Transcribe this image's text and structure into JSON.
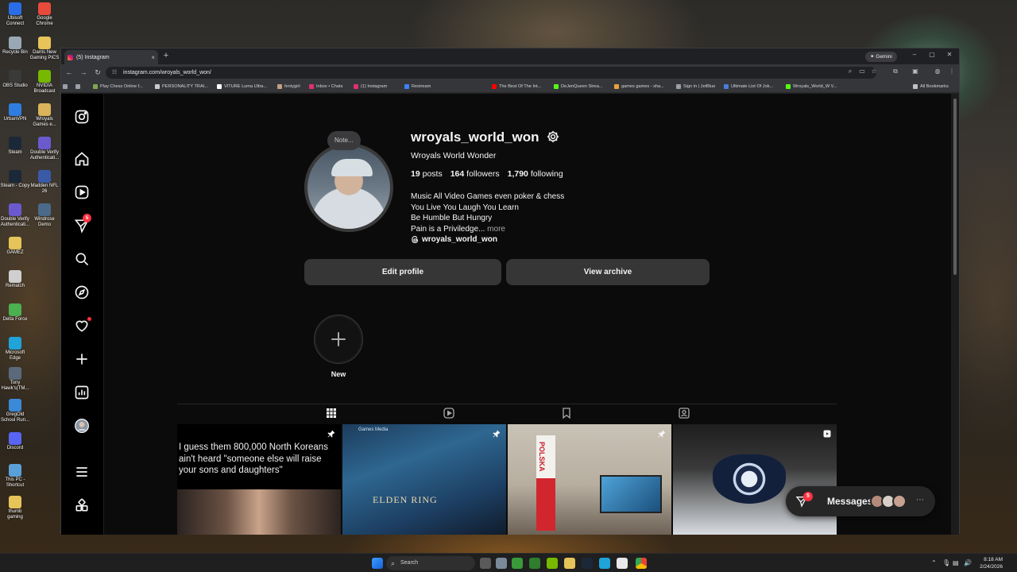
{
  "desktop": {
    "icons": [
      {
        "label": "Ubisoft Connect",
        "color": "#2b6de8"
      },
      {
        "label": "Google Chrome",
        "color": "#e84a3c"
      },
      {
        "label": "Recycle Bin",
        "color": "#9aa7b5"
      },
      {
        "label": "Darris New Gaming PICS",
        "color": "#e6c45a"
      },
      {
        "label": "OBS Studio",
        "color": "#3a3a3a"
      },
      {
        "label": "NVIDIA Broadcast",
        "color": "#76b900"
      },
      {
        "label": "UrbanVPN",
        "color": "#2f7de1"
      },
      {
        "label": "Wroyals Games e...",
        "color": "#d9b45a"
      },
      {
        "label": "Steam",
        "color": "#1b2838"
      },
      {
        "label": "Double Verify Authenticati...",
        "color": "#6a5acd"
      },
      {
        "label": "Steam - Copy",
        "color": "#1b2838"
      },
      {
        "label": "Madden NFL 26",
        "color": "#3a5aa8"
      },
      {
        "label": "Double Verify Authenticati...",
        "color": "#6a5acd"
      },
      {
        "label": "Windrose Demo",
        "color": "#4a6a8a"
      },
      {
        "label": "GAMEZ",
        "color": "#e6c45a"
      },
      {
        "label": "Rematch",
        "color": "#cfcfcf"
      },
      {
        "label": "Delta Force",
        "color": "#4caf50"
      },
      {
        "label": "Microsoft Edge",
        "color": "#1fa3d9"
      },
      {
        "label": "Tony Hawk's(TM...",
        "color": "#5a6a7a"
      },
      {
        "label": "GregOld School Run...",
        "color": "#3a8ad8"
      },
      {
        "label": "Discord",
        "color": "#5865f2"
      },
      {
        "label": "This PC - Shortcut",
        "color": "#5aa0d8"
      },
      {
        "label": "thumb gaming",
        "color": "#e6c45a"
      }
    ]
  },
  "browser": {
    "tab_title": "(5) Instagram",
    "tab_close": "×",
    "new_tab": "+",
    "gemini_label": "Gemini",
    "url": "instagram.com/wroyals_world_won/",
    "bookmarks": [
      {
        "label": "Play Chess Online f...",
        "color": "#7fa650"
      },
      {
        "label": "PERSONALITY TRAI...",
        "color": "#c9c9c9"
      },
      {
        "label": "VITURE Luma Ultra...",
        "color": "#ffffff"
      },
      {
        "label": "fentygirl",
        "color": "#c0a080"
      },
      {
        "label": "Inbox • Chats",
        "color": "#e1306c"
      },
      {
        "label": "(1) Instagram",
        "color": "#e1306c"
      },
      {
        "label": "Restream",
        "color": "#3b82f6"
      },
      {
        "label": "The Best Of The Int...",
        "color": "#ff0000"
      },
      {
        "label": "DeJenQueen Strea...",
        "color": "#53fc18"
      },
      {
        "label": "games games - sha...",
        "color": "#e8a23a"
      },
      {
        "label": "Sign in | JetBlue",
        "color": "#9aa0a6"
      },
      {
        "label": "Ultimate List Of Jok...",
        "color": "#4a7bd8"
      },
      {
        "label": "Wroyals_World_W V...",
        "color": "#53fc18"
      }
    ],
    "all_bookmarks": "All Bookmarks"
  },
  "sidebar": {
    "notifications_badge": "5"
  },
  "profile": {
    "note": "Note...",
    "username": "wroyals_world_won",
    "full_name": "Wroyals World Wonder",
    "posts_count": "19",
    "posts_label": "posts",
    "followers_count": "164",
    "followers_label": "followers",
    "following_count": "1,790",
    "following_label": "following",
    "bio_lines": [
      "Music All Video Games even poker & chess",
      "You Live You Laugh You Learn",
      "Be Humble But Hungry",
      "Pain is a Priviledge..."
    ],
    "bio_more": "more",
    "threads_handle": "wroyals_world_won",
    "edit_profile": "Edit profile",
    "view_archive": "View archive",
    "new_story_label": "New"
  },
  "posts": [
    {
      "caption": "I guess them 800,000 North Koreans ain't heard \"someone else will raise your sons and daughters\""
    },
    {
      "overlay": "ELDEN RING",
      "tabs": "Games    Media"
    },
    {
      "overlay": "POLSKA"
    },
    {
      "overlay": ""
    }
  ],
  "messages": {
    "label": "Messages",
    "badge": "5",
    "avatar_colors": [
      "#b58a7a",
      "#d8d0c8",
      "#c7a090"
    ]
  },
  "taskbar": {
    "search": "Search",
    "time": "8:18 AM",
    "date": "2/24/2026"
  }
}
